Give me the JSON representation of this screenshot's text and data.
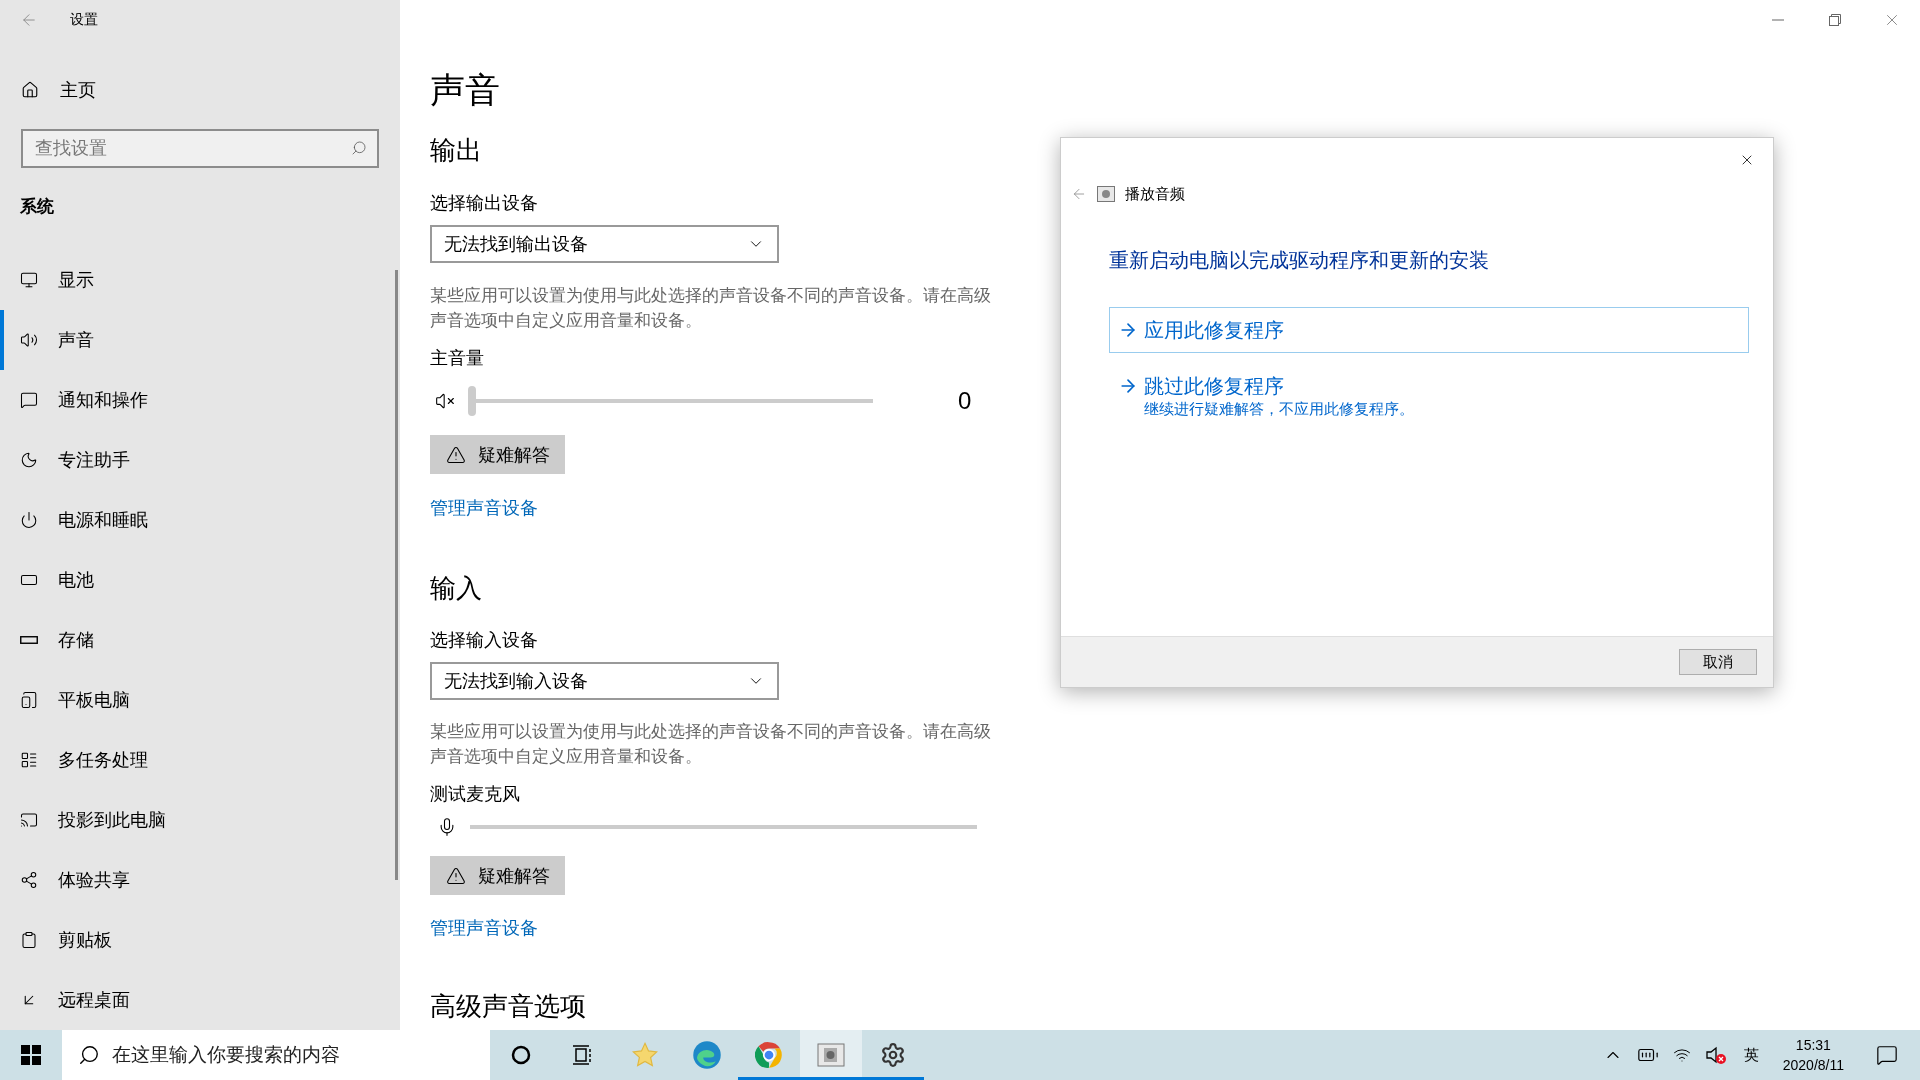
{
  "window": {
    "title": "设置"
  },
  "sidebar": {
    "home": "主页",
    "search": {
      "placeholder": "查找设置"
    },
    "section": "系统",
    "items": [
      {
        "label": "显示",
        "selected": false
      },
      {
        "label": "声音",
        "selected": true
      },
      {
        "label": "通知和操作",
        "selected": false
      },
      {
        "label": "专注助手",
        "selected": false
      },
      {
        "label": "电源和睡眠",
        "selected": false
      },
      {
        "label": "电池",
        "selected": false
      },
      {
        "label": "存储",
        "selected": false
      },
      {
        "label": "平板电脑",
        "selected": false
      },
      {
        "label": "多任务处理",
        "selected": false
      },
      {
        "label": "投影到此电脑",
        "selected": false
      },
      {
        "label": "体验共享",
        "selected": false
      },
      {
        "label": "剪贴板",
        "selected": false
      },
      {
        "label": "远程桌面",
        "selected": false
      }
    ]
  },
  "page": {
    "title": "声音",
    "sections": [
      {
        "kind": "output",
        "heading": "输出",
        "device_label": "选择输出设备",
        "device": "无法找到输出设备",
        "description": "某些应用可以设置为使用与此处选择的声音设备不同的声音设备。请在高级声音选项中自定义应用音量和设备。",
        "control_label": "主音量",
        "level": 0,
        "reading": "0",
        "troubleshoot": "疑难解答",
        "manage_link": "管理声音设备"
      },
      {
        "kind": "input",
        "heading": "输入",
        "device_label": "选择输入设备",
        "device": "无法找到输入设备",
        "description": "某些应用可以设置为使用与此处选择的声音设备不同的声音设备。请在高级声音选项中自定义应用音量和设备。",
        "control_label": "测试麦克风",
        "level": 0,
        "troubleshoot": "疑难解答",
        "manage_link": "管理声音设备"
      }
    ],
    "advanced_heading": "高级声音选项"
  },
  "dialog": {
    "title": "播放音频",
    "heading": "重新启动电脑以完成驱动程序和更新的安装",
    "options": [
      {
        "label": "应用此修复程序",
        "focused": true
      },
      {
        "label": "跳过此修复程序",
        "description": "继续进行疑难解答，不应用此修复程序。",
        "focused": false
      }
    ],
    "cancel": "取消"
  },
  "taskbar": {
    "search": {
      "placeholder": "在这里输入你要搜索的内容"
    },
    "apps": [
      {
        "running": false,
        "selected": false
      },
      {
        "running": false,
        "selected": false
      },
      {
        "running": true,
        "selected": false
      },
      {
        "running": true,
        "selected": true
      },
      {
        "running": true,
        "selected": false
      }
    ],
    "tray": {
      "ime": "英",
      "time": "15:31",
      "date": "2020/8/11"
    }
  }
}
